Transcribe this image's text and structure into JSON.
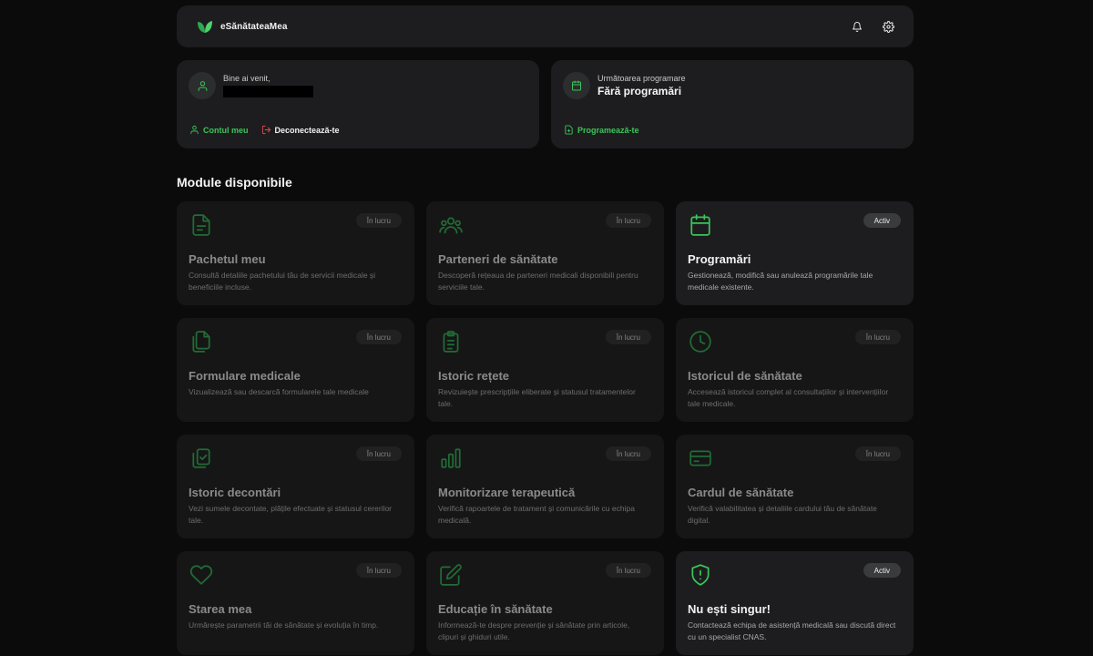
{
  "header": {
    "brand_name": "eSănătateaMea"
  },
  "account_card": {
    "welcome": "Bine ai venit,",
    "account_link": "Contul meu",
    "logout_link": "Deconectează-te"
  },
  "appointment_card": {
    "label": "Următoarea programare",
    "value": "Fără programări",
    "schedule_link": "Programează-te"
  },
  "section_title": "Module disponibile",
  "modules": [
    {
      "title": "Pachetul meu",
      "desc": "Consultă detaliile pachetului tău de servicii medicale și beneficiile incluse.",
      "badge": "În lucru",
      "icon": "document-icon"
    },
    {
      "title": "Parteneri de sănătate",
      "desc": "Descoperă rețeaua de parteneri medicali disponibili pentru serviciile tale.",
      "badge": "În lucru",
      "icon": "users-icon"
    },
    {
      "title": "Programări",
      "desc": "Gestionează, modifică sau anulează programările tale medicale existente.",
      "badge": "Activ",
      "icon": "calendar-icon"
    },
    {
      "title": "Formulare medicale",
      "desc": "Vizualizează sau descarcă formularele tale medicale",
      "badge": "În lucru",
      "icon": "files-icon"
    },
    {
      "title": "Istoric rețete",
      "desc": "Revizuiește prescripțiile eliberate și statusul tratamentelor tale.",
      "badge": "În lucru",
      "icon": "clipboard-icon"
    },
    {
      "title": "Istoricul de sănătate",
      "desc": "Accesează istoricul complet al consultațiilor și intervențiilor tale medicale.",
      "badge": "În lucru",
      "icon": "clock-icon"
    },
    {
      "title": "Istoric decontări",
      "desc": "Vezi sumele decontate, plățile efectuate și statusul cererilor tale.",
      "badge": "În lucru",
      "icon": "copy-check-icon"
    },
    {
      "title": "Monitorizare terapeutică",
      "desc": "Verifică rapoartele de tratament și comunicările cu echipa medicală.",
      "badge": "În lucru",
      "icon": "bar-chart-icon"
    },
    {
      "title": "Cardul de sănătate",
      "desc": "Verifică valabilitatea și detaliile cardului tău de sănătate digital.",
      "badge": "În lucru",
      "icon": "credit-card-icon"
    },
    {
      "title": "Starea mea",
      "desc": "Urmărește parametrii tăi de sănătate și evoluția în timp.",
      "badge": "În lucru",
      "icon": "heart-icon"
    },
    {
      "title": "Educație în sănătate",
      "desc": "Informează-te despre prevenție și sănătate prin articole, clipuri și ghiduri utile.",
      "badge": "În lucru",
      "icon": "edit-icon"
    },
    {
      "title": "Nu ești singur!",
      "desc": "Contactează echipa de asistență medicală sau discută direct cu un specialist CNAS.",
      "badge": "Activ",
      "icon": "shield-alert-icon"
    }
  ],
  "colors": {
    "accent": "#3cc45a",
    "danger": "#e5484d",
    "card_bg": "#1d1d1f",
    "page_bg": "#0b0b0c"
  }
}
